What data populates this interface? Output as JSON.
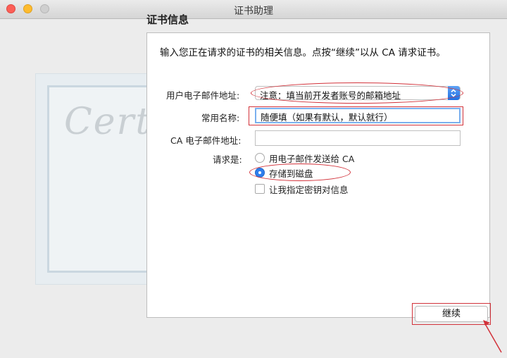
{
  "window": {
    "title": "证书助理"
  },
  "section_title": "证书信息",
  "instruction": "输入您正在请求的证书的相关信息。点按“继续”以从 CA 请求证书。",
  "decoration": {
    "certificate_word": "Certif"
  },
  "form": {
    "email_label": "用户电子邮件地址:",
    "email_value": "注意：填当前开发者账号的邮箱地址",
    "common_name_label": "常用名称:",
    "common_name_value": "随便填（如果有默认，默认就行）",
    "ca_email_label": "CA 电子邮件地址:",
    "ca_email_value": "",
    "request_label": "请求是:",
    "options": {
      "email_to_ca": "用电子邮件发送给 CA",
      "save_to_disk": "存储到磁盘",
      "specify_key_pair": "让我指定密钥对信息"
    },
    "selected_option": "save_to_disk",
    "specify_key_pair_checked": false
  },
  "buttons": {
    "continue": "继续"
  },
  "colors": {
    "accent_blue": "#2f7fed",
    "annotation_red": "#d2323a"
  }
}
